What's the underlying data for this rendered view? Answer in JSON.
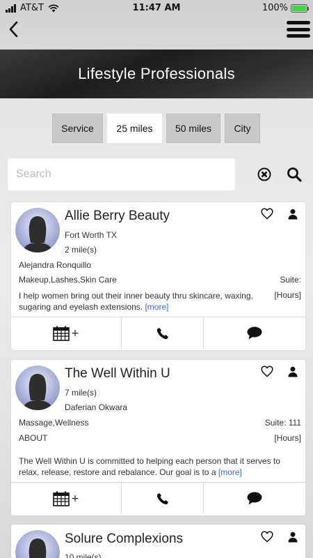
{
  "status_bar": {
    "carrier": "AT&T",
    "time": "11:47 AM",
    "battery": "100%",
    "battery_level": 1.0
  },
  "header": {
    "title": "Lifestyle Professionals"
  },
  "filters": [
    {
      "label": "Service",
      "active": false
    },
    {
      "label": "25 miles",
      "active": true
    },
    {
      "label": "50 miles",
      "active": false
    },
    {
      "label": "City",
      "active": false
    }
  ],
  "search": {
    "placeholder": "Search",
    "value": ""
  },
  "listings": [
    {
      "name": "Allie Berry Beauty",
      "location": "Fort Worth TX",
      "distance": "2 mile(s)",
      "owner": "Alejandra Ronquillo",
      "services": "Makeup,Lashes,Skin Care",
      "suite": "Suite:",
      "hours": "[Hours]",
      "description": "I help women bring out their inner beauty thru skincare, waxing, sugaring and eyelash extensions.",
      "more": "[more]"
    },
    {
      "name": "The Well Within U",
      "distance": "7 mile(s)",
      "owner": "Daferian Okwara",
      "services": "Massage,Wellness",
      "suite": "Suite: 111",
      "about": "ABOUT",
      "hours": "[Hours]",
      "description": "The Well Within U is committed to helping each person that it serves to relax, release, restore and rebalance. Our goal is to a",
      "more": "[more]"
    },
    {
      "name": "Solure Complexions",
      "distance": "10 mile(s)"
    }
  ],
  "actions": {
    "book_plus": "+"
  },
  "icons": {
    "back": "chevron-left-icon",
    "menu": "hamburger-menu-icon",
    "clear": "clear-circle-x-icon",
    "search": "magnifier-icon",
    "heart": "heart-outline-icon",
    "person": "person-icon",
    "calendar": "calendar-icon",
    "phone": "phone-icon",
    "message": "speech-bubble-icon"
  },
  "colors": {
    "link": "#3a66c8",
    "battery": "#44d244"
  }
}
